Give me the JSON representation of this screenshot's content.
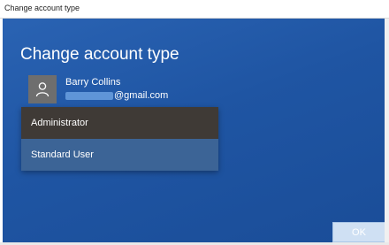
{
  "window": {
    "title": "Change account type"
  },
  "dialog": {
    "heading": "Change account type",
    "user": {
      "name": "Barry Collins",
      "email_visible_part": "@gmail.com"
    },
    "account_type_options": [
      "Administrator",
      "Standard User"
    ],
    "selected_option": "Administrator",
    "ok_label": "OK"
  },
  "icons": {
    "avatar": "person-icon"
  },
  "colors": {
    "background": "#1f55a3",
    "selected_option": "#3f3a36",
    "unselected_option": "#3c6496",
    "avatar_bg": "#6e6e6e",
    "ok_button": "#cfe0f3"
  }
}
